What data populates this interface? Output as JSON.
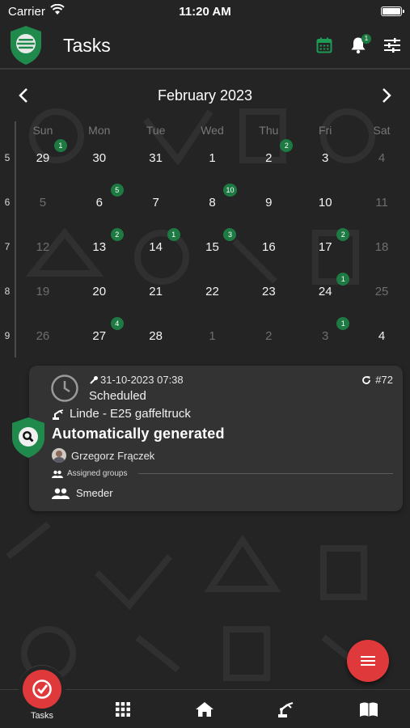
{
  "status_bar": {
    "carrier": "Carrier",
    "time": "11:20 AM"
  },
  "app_bar": {
    "title": "Tasks",
    "notification_count": "1",
    "accent_color": "#1e7a43"
  },
  "calendar": {
    "month_label": "February 2023",
    "weekdays": [
      "Sun",
      "Mon",
      "Tue",
      "Wed",
      "Thu",
      "Fri",
      "Sat"
    ],
    "week_numbers": [
      "5",
      "6",
      "7",
      "8",
      "9"
    ],
    "weeks": [
      [
        {
          "d": "29",
          "m": false,
          "b": "1"
        },
        {
          "d": "30",
          "m": false,
          "b": ""
        },
        {
          "d": "31",
          "m": false,
          "b": ""
        },
        {
          "d": "1",
          "m": false,
          "b": ""
        },
        {
          "d": "2",
          "m": false,
          "b": "2"
        },
        {
          "d": "3",
          "m": false,
          "b": ""
        },
        {
          "d": "4",
          "m": true,
          "b": ""
        }
      ],
      [
        {
          "d": "5",
          "m": true,
          "b": ""
        },
        {
          "d": "6",
          "m": false,
          "b": "5"
        },
        {
          "d": "7",
          "m": false,
          "b": ""
        },
        {
          "d": "8",
          "m": false,
          "b": "10"
        },
        {
          "d": "9",
          "m": false,
          "b": ""
        },
        {
          "d": "10",
          "m": false,
          "b": ""
        },
        {
          "d": "11",
          "m": true,
          "b": ""
        }
      ],
      [
        {
          "d": "12",
          "m": true,
          "b": ""
        },
        {
          "d": "13",
          "m": false,
          "b": "2"
        },
        {
          "d": "14",
          "m": false,
          "b": "1"
        },
        {
          "d": "15",
          "m": false,
          "b": "3"
        },
        {
          "d": "16",
          "m": false,
          "b": ""
        },
        {
          "d": "17",
          "m": false,
          "b": "2"
        },
        {
          "d": "18",
          "m": true,
          "b": ""
        }
      ],
      [
        {
          "d": "19",
          "m": true,
          "b": ""
        },
        {
          "d": "20",
          "m": false,
          "b": ""
        },
        {
          "d": "21",
          "m": false,
          "b": ""
        },
        {
          "d": "22",
          "m": false,
          "b": ""
        },
        {
          "d": "23",
          "m": false,
          "b": ""
        },
        {
          "d": "24",
          "m": false,
          "b": "1"
        },
        {
          "d": "25",
          "m": true,
          "b": ""
        }
      ],
      [
        {
          "d": "26",
          "m": true,
          "b": ""
        },
        {
          "d": "27",
          "m": false,
          "b": "4"
        },
        {
          "d": "28",
          "m": false,
          "b": ""
        },
        {
          "d": "1",
          "m": true,
          "b": ""
        },
        {
          "d": "2",
          "m": true,
          "b": ""
        },
        {
          "d": "3",
          "m": true,
          "b": "1"
        },
        {
          "d": "4",
          "m": false,
          "b": ""
        }
      ]
    ]
  },
  "task": {
    "datetime": "31-10-2023 07:38",
    "id": "#72",
    "status": "Scheduled",
    "machine": "Linde - E25 gaffeltruck",
    "title": "Automatically generated",
    "user": "Grzegorz Frączek",
    "groups_label": "Assigned groups",
    "group": "Smeder"
  },
  "bottom_nav": {
    "tasks_label": "Tasks",
    "brand_color": "#e0393b"
  }
}
